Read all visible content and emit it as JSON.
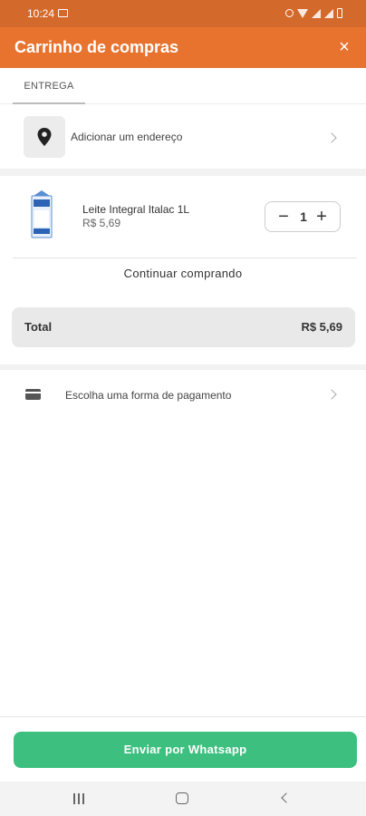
{
  "status_bar": {
    "time": "10:24",
    "icons": [
      "image-icon",
      "alarm-icon",
      "wifi-icon",
      "signal-icon",
      "signal-icon",
      "battery-icon"
    ]
  },
  "app_bar": {
    "title": "Carrinho de compras",
    "close_label": "×",
    "background": "#e8732f"
  },
  "tabs": [
    {
      "label": "ENTREGA",
      "active": true
    }
  ],
  "address": {
    "label": "Adicionar um endereço",
    "icon": "location-pin-icon"
  },
  "cart": {
    "items": [
      {
        "name": "Leite Integral Italac 1L",
        "price": "R$ 5,69",
        "quantity": "1",
        "minus_label": "−",
        "plus_label": "+"
      }
    ],
    "continue_label": "Continuar comprando"
  },
  "total": {
    "label": "Total",
    "value": "R$ 5,69"
  },
  "payment": {
    "label": "Escolha uma forma de pagamento",
    "icon": "credit-card-icon"
  },
  "submit": {
    "label": "Enviar por Whatsapp",
    "color": "#3dc07f"
  },
  "nav_bar": {
    "buttons": [
      "recents-icon",
      "home-icon",
      "back-icon"
    ]
  }
}
